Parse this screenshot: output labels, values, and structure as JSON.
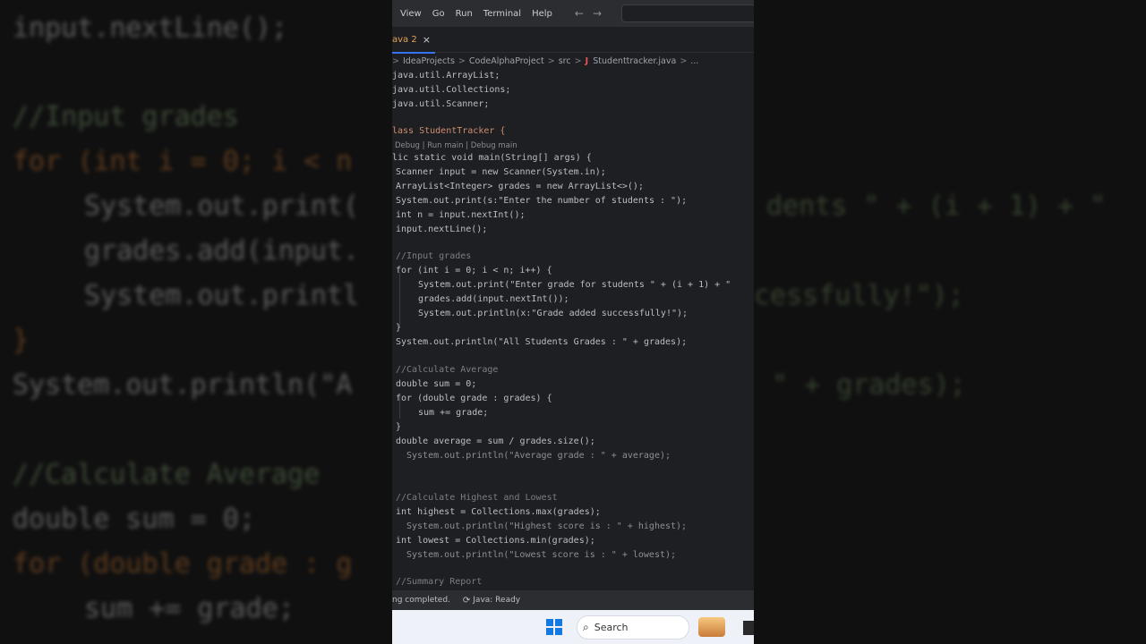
{
  "menu": {
    "items": [
      "View",
      "Go",
      "Run",
      "Terminal",
      "Help"
    ],
    "back_arrow": "←",
    "forward_arrow": "→"
  },
  "tab": {
    "label": "ava 2",
    "close": "×"
  },
  "breadcrumb": {
    "parts": [
      "IdeaProjects",
      "CodeAlphaProject",
      "src",
      "Studenttracker.java",
      "..."
    ],
    "separator": ">"
  },
  "editor": {
    "lines": [
      {
        "t": "java.util.ArrayList;"
      },
      {
        "t": "java.util.Collections;"
      },
      {
        "t": "java.util.Scanner;"
      },
      {
        "t": "lass StudentTracker {"
      },
      {
        "t": "Debug | Run main | Debug main"
      },
      {
        "t": "lic static void main(String[] args) {"
      },
      {
        "t": "Scanner input = new Scanner(System.in);"
      },
      {
        "t": "ArrayList<Integer> grades = new ArrayList<>();"
      },
      {
        "t": "System.out.print(s:\"Enter the number of students : \");"
      },
      {
        "t": "int n = input.nextInt();"
      },
      {
        "t": "input.nextLine();"
      },
      {
        "t": "//Input grades"
      },
      {
        "t": "for (int i = 0; i < n; i++) {"
      },
      {
        "t": "System.out.print(\"Enter grade for students \" + (i + 1) + \""
      },
      {
        "t": "grades.add(input.nextInt());"
      },
      {
        "t": "System.out.println(x:\"Grade added successfully!\");"
      },
      {
        "t": "}"
      },
      {
        "t": "System.out.println(\"All Students Grades : \" + grades);"
      },
      {
        "t": "//Calculate Average"
      },
      {
        "t": "double sum = 0;"
      },
      {
        "t": "for (double grade : grades) {"
      },
      {
        "t": "sum += grade;"
      },
      {
        "t": "}"
      },
      {
        "t": "double average = sum / grades.size();"
      },
      {
        "t": "System.out.println(\"Average grade : \" + average);"
      },
      {
        "t": "//Calculate Highest and Lowest"
      },
      {
        "t": "int highest = Collections.max(grades);"
      },
      {
        "t": "System.out.println(\"Highest score is : \" + highest);"
      },
      {
        "t": "int lowest = Collections.min(grades);"
      },
      {
        "t": "System.out.println(\"Lowest score is : \" + lowest);"
      },
      {
        "t": "//Summary Report"
      }
    ]
  },
  "status": {
    "left": "ng completed.",
    "ready": "Java: Ready"
  },
  "taskbar": {
    "search_label": "Search"
  },
  "background": {
    "lines": [
      "input.nextLine();",
      "//Input grades",
      "for (int i = 0; i < n",
      "System.out.print(",
      "grades.add(input.",
      "System.out.printl",
      "}",
      "System.out.println(\"A",
      "//Calculate Average",
      "double sum = 0;",
      "for (double grade : g",
      "sum += grade;",
      "dents \" + (i + 1) + \"",
      "cessfully!\");",
      "\" + grades);"
    ]
  },
  "colors": {
    "accent": "#3574f0",
    "java_file": "#e05252",
    "taskbar": "#eef2f8"
  }
}
